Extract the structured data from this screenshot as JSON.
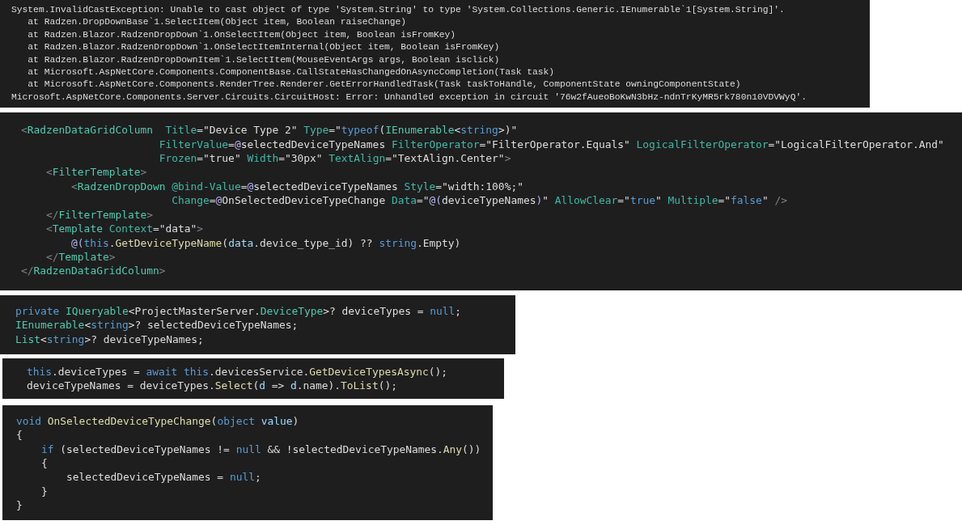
{
  "panels": [
    {
      "kind": "console",
      "lines": [
        "System.InvalidCastException: Unable to cast object of type 'System.String' to type 'System.Collections.Generic.IEnumerable`1[System.String]'.",
        "   at Radzen.DropDownBase`1.SelectItem(Object item, Boolean raiseChange)",
        "   at Radzen.Blazor.RadzenDropDown`1.OnSelectItem(Object item, Boolean isFromKey)",
        "   at Radzen.Blazor.RadzenDropDown`1.OnSelectItemInternal(Object item, Boolean isFromKey)",
        "   at Radzen.Blazor.RadzenDropDownItem`1.SelectItem(MouseEventArgs args, Boolean isclick)",
        "   at Microsoft.AspNetCore.Components.ComponentBase.CallStateHasChangedOnAsyncCompletion(Task task)",
        "   at Microsoft.AspNetCore.Components.RenderTree.Renderer.GetErrorHandledTask(Task taskToHandle, ComponentState owningComponentState)",
        "Microsoft.AspNetCore.Components.Server.Circuits.CircuitHost: Error: Unhandled exception in circuit '76w2fAueoBoKwN3bHz-ndnTrKyMR5rk780n10VDVWyQ'."
      ]
    },
    {
      "kind": "code",
      "lines": [
        [
          {
            "kind": "punct",
            "text": "<"
          },
          {
            "kind": "tag",
            "text": "RadzenDataGridColumn"
          },
          {
            "kind": "attr",
            "text": "  Title"
          },
          {
            "kind": "plain",
            "text": "=\"Device Type 2\" "
          },
          {
            "kind": "attr",
            "text": "Type"
          },
          {
            "kind": "plain",
            "text": "=\""
          },
          {
            "kind": "keyword",
            "text": "typeof"
          },
          {
            "kind": "plain",
            "text": "("
          },
          {
            "kind": "type",
            "text": "IEnumerable"
          },
          {
            "kind": "plain",
            "text": "<"
          },
          {
            "kind": "keyword",
            "text": "string"
          },
          {
            "kind": "plain",
            "text": ">)\""
          }
        ],
        [
          {
            "kind": "attr",
            "text": "                      FilterValue"
          },
          {
            "kind": "plain",
            "text": "="
          },
          {
            "kind": "razor",
            "text": "@"
          },
          {
            "kind": "plain",
            "text": "selectedDeviceTypeNames "
          },
          {
            "kind": "attr",
            "text": "FilterOperator"
          },
          {
            "kind": "plain",
            "text": "=\"FilterOperator.Equals\" "
          },
          {
            "kind": "attr",
            "text": "LogicalFilterOperator"
          },
          {
            "kind": "plain",
            "text": "=\"LogicalFilterOperator.And\""
          }
        ],
        [
          {
            "kind": "attr",
            "text": "                      Frozen"
          },
          {
            "kind": "plain",
            "text": "=\"true\" "
          },
          {
            "kind": "attr",
            "text": "Width"
          },
          {
            "kind": "plain",
            "text": "=\"30px\" "
          },
          {
            "kind": "attr",
            "text": "TextAlign"
          },
          {
            "kind": "plain",
            "text": "=\"TextAlign.Center\""
          },
          {
            "kind": "punct",
            "text": ">"
          }
        ],
        [
          {
            "kind": "punct",
            "text": "    <"
          },
          {
            "kind": "tag",
            "text": "FilterTemplate"
          },
          {
            "kind": "punct",
            "text": ">"
          }
        ],
        [
          {
            "kind": "punct",
            "text": "        <"
          },
          {
            "kind": "tag",
            "text": "RadzenDropDown"
          },
          {
            "kind": "attr",
            "text": " @bind-Value"
          },
          {
            "kind": "plain",
            "text": "="
          },
          {
            "kind": "razor",
            "text": "@"
          },
          {
            "kind": "plain",
            "text": "selectedDeviceTypeNames "
          },
          {
            "kind": "attr",
            "text": "Style"
          },
          {
            "kind": "plain",
            "text": "=\"width:100%;\""
          }
        ],
        [
          {
            "kind": "attr",
            "text": "                        Change"
          },
          {
            "kind": "plain",
            "text": "="
          },
          {
            "kind": "razor",
            "text": "@"
          },
          {
            "kind": "plain",
            "text": "OnSelectedDeviceTypeChange "
          },
          {
            "kind": "attr",
            "text": "Data"
          },
          {
            "kind": "plain",
            "text": "=\""
          },
          {
            "kind": "razor",
            "text": "@("
          },
          {
            "kind": "plain",
            "text": "deviceTypeNames"
          },
          {
            "kind": "razor",
            "text": ")"
          },
          {
            "kind": "plain",
            "text": "\" "
          },
          {
            "kind": "attr",
            "text": "AllowClear"
          },
          {
            "kind": "plain",
            "text": "=\""
          },
          {
            "kind": "keyword",
            "text": "true"
          },
          {
            "kind": "plain",
            "text": "\" "
          },
          {
            "kind": "attr",
            "text": "Multiple"
          },
          {
            "kind": "plain",
            "text": "=\""
          },
          {
            "kind": "keyword",
            "text": "false"
          },
          {
            "kind": "plain",
            "text": "\" "
          },
          {
            "kind": "punct",
            "text": "/>"
          }
        ],
        [
          {
            "kind": "punct",
            "text": "    </"
          },
          {
            "kind": "tag",
            "text": "FilterTemplate"
          },
          {
            "kind": "punct",
            "text": ">"
          }
        ],
        [
          {
            "kind": "punct",
            "text": "    <"
          },
          {
            "kind": "tag",
            "text": "Template"
          },
          {
            "kind": "attr",
            "text": " Context"
          },
          {
            "kind": "plain",
            "text": "=\"data\""
          },
          {
            "kind": "punct",
            "text": ">"
          }
        ],
        [
          {
            "kind": "razor",
            "text": "        @("
          },
          {
            "kind": "keyword",
            "text": "this"
          },
          {
            "kind": "plain",
            "text": "."
          },
          {
            "kind": "method",
            "text": "GetDeviceTypeName"
          },
          {
            "kind": "plain",
            "text": "("
          },
          {
            "kind": "param",
            "text": "data"
          },
          {
            "kind": "plain",
            "text": ".device_type_id) ?? "
          },
          {
            "kind": "keyword",
            "text": "string"
          },
          {
            "kind": "plain",
            "text": ".Empty)"
          }
        ],
        [
          {
            "kind": "punct",
            "text": "    </"
          },
          {
            "kind": "tag",
            "text": "Template"
          },
          {
            "kind": "punct",
            "text": ">"
          }
        ],
        [
          {
            "kind": "punct",
            "text": "</"
          },
          {
            "kind": "tag",
            "text": "RadzenDataGridColumn"
          },
          {
            "kind": "punct",
            "text": ">"
          }
        ]
      ]
    },
    {
      "kind": "code",
      "lines": [
        [
          {
            "kind": "keyword",
            "text": "private "
          },
          {
            "kind": "type",
            "text": "IQueryable"
          },
          {
            "kind": "plain",
            "text": "<ProjectMasterServer."
          },
          {
            "kind": "type",
            "text": "DeviceType"
          },
          {
            "kind": "plain",
            "text": ">? deviceTypes = "
          },
          {
            "kind": "keyword",
            "text": "null"
          },
          {
            "kind": "plain",
            "text": ";"
          }
        ],
        [
          {
            "kind": "type",
            "text": "IEnumerable"
          },
          {
            "kind": "plain",
            "text": "<"
          },
          {
            "kind": "keyword",
            "text": "string"
          },
          {
            "kind": "plain",
            "text": ">? selectedDeviceTypeNames;"
          }
        ],
        [
          {
            "kind": "type",
            "text": "List"
          },
          {
            "kind": "plain",
            "text": "<"
          },
          {
            "kind": "keyword",
            "text": "string"
          },
          {
            "kind": "plain",
            "text": ">? deviceTypeNames;"
          }
        ]
      ]
    },
    {
      "kind": "code",
      "lines": [
        [
          {
            "kind": "keyword",
            "text": "this"
          },
          {
            "kind": "plain",
            "text": ".deviceTypes = "
          },
          {
            "kind": "keyword",
            "text": "await"
          },
          {
            "kind": "keyword",
            "text": " this"
          },
          {
            "kind": "plain",
            "text": ".devicesService."
          },
          {
            "kind": "method",
            "text": "GetDeviceTypesAsync"
          },
          {
            "kind": "plain",
            "text": "();"
          }
        ],
        [
          {
            "kind": "plain",
            "text": "deviceTypeNames = deviceTypes."
          },
          {
            "kind": "method",
            "text": "Select"
          },
          {
            "kind": "plain",
            "text": "("
          },
          {
            "kind": "param",
            "text": "d"
          },
          {
            "kind": "plain",
            "text": " => "
          },
          {
            "kind": "param",
            "text": "d"
          },
          {
            "kind": "plain",
            "text": ".name)."
          },
          {
            "kind": "method",
            "text": "ToList"
          },
          {
            "kind": "plain",
            "text": "();"
          }
        ]
      ]
    },
    {
      "kind": "code",
      "lines": [
        [
          {
            "kind": "keyword",
            "text": "void "
          },
          {
            "kind": "method",
            "text": "OnSelectedDeviceTypeChange"
          },
          {
            "kind": "plain",
            "text": "("
          },
          {
            "kind": "keyword",
            "text": "object "
          },
          {
            "kind": "param",
            "text": "value"
          },
          {
            "kind": "plain",
            "text": ")"
          }
        ],
        [
          {
            "kind": "plain",
            "text": "{"
          }
        ],
        [
          {
            "kind": "keyword",
            "text": "    if"
          },
          {
            "kind": "plain",
            "text": " (selectedDeviceTypeNames != "
          },
          {
            "kind": "keyword",
            "text": "null"
          },
          {
            "kind": "plain",
            "text": " && !selectedDeviceTypeNames."
          },
          {
            "kind": "method",
            "text": "Any"
          },
          {
            "kind": "plain",
            "text": "())"
          }
        ],
        [
          {
            "kind": "plain",
            "text": "    {"
          }
        ],
        [
          {
            "kind": "plain",
            "text": "        selectedDeviceTypeNames = "
          },
          {
            "kind": "keyword",
            "text": "null"
          },
          {
            "kind": "plain",
            "text": ";"
          }
        ],
        [
          {
            "kind": "plain",
            "text": "    }"
          }
        ],
        [
          {
            "kind": "plain",
            "text": "}"
          }
        ]
      ]
    }
  ]
}
